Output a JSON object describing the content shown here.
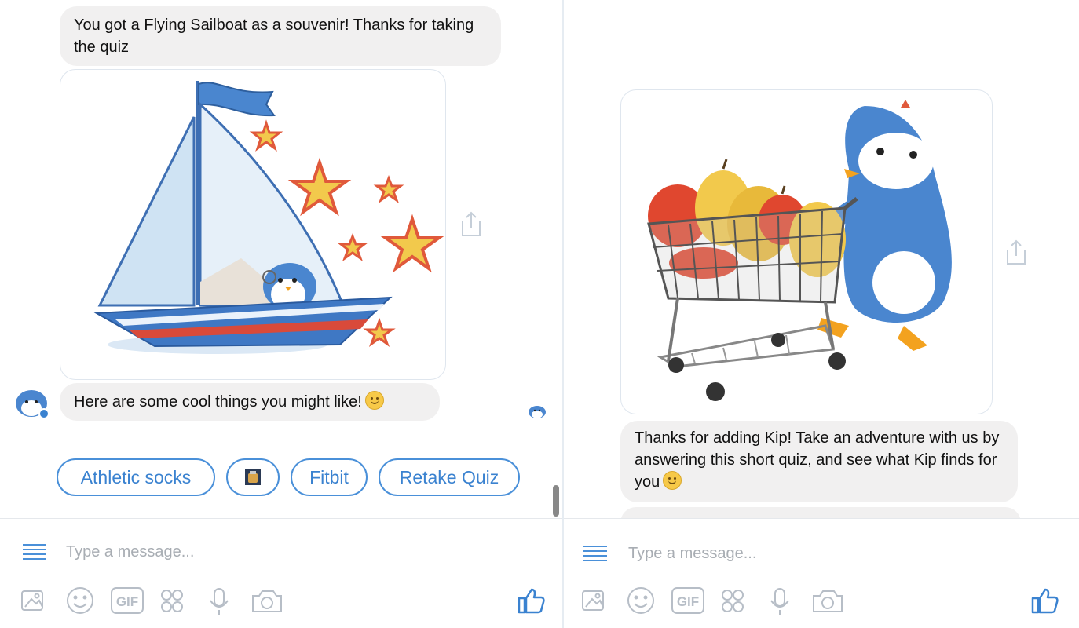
{
  "left": {
    "messages": [
      "You got a Flying Sailboat as a souvenir! Thanks for taking the quiz",
      "Here are some cool things you might like!"
    ],
    "quick_replies": [
      "Athletic socks",
      "Fitbit",
      "Retake Quiz"
    ],
    "composer": {
      "placeholder": "Type a message..."
    }
  },
  "right": {
    "messages": [
      "Thanks for adding Kip! Take an adventure with us by answering this short quiz, and see what Kip finds for you"
    ],
    "composer": {
      "placeholder": "Type a message..."
    }
  },
  "icons": {
    "menu": "menu-icon",
    "photo": "photo-icon",
    "emoji": "emoji-icon",
    "gif": "gif-icon",
    "stickers": "sticker-icon",
    "mic": "microphone-icon",
    "camera": "camera-icon",
    "like": "thumbs-up-icon",
    "share": "share-icon"
  },
  "colors": {
    "accent": "#4a90d9",
    "bubble": "#f1f0f0",
    "placeholder": "#a8adb3"
  }
}
